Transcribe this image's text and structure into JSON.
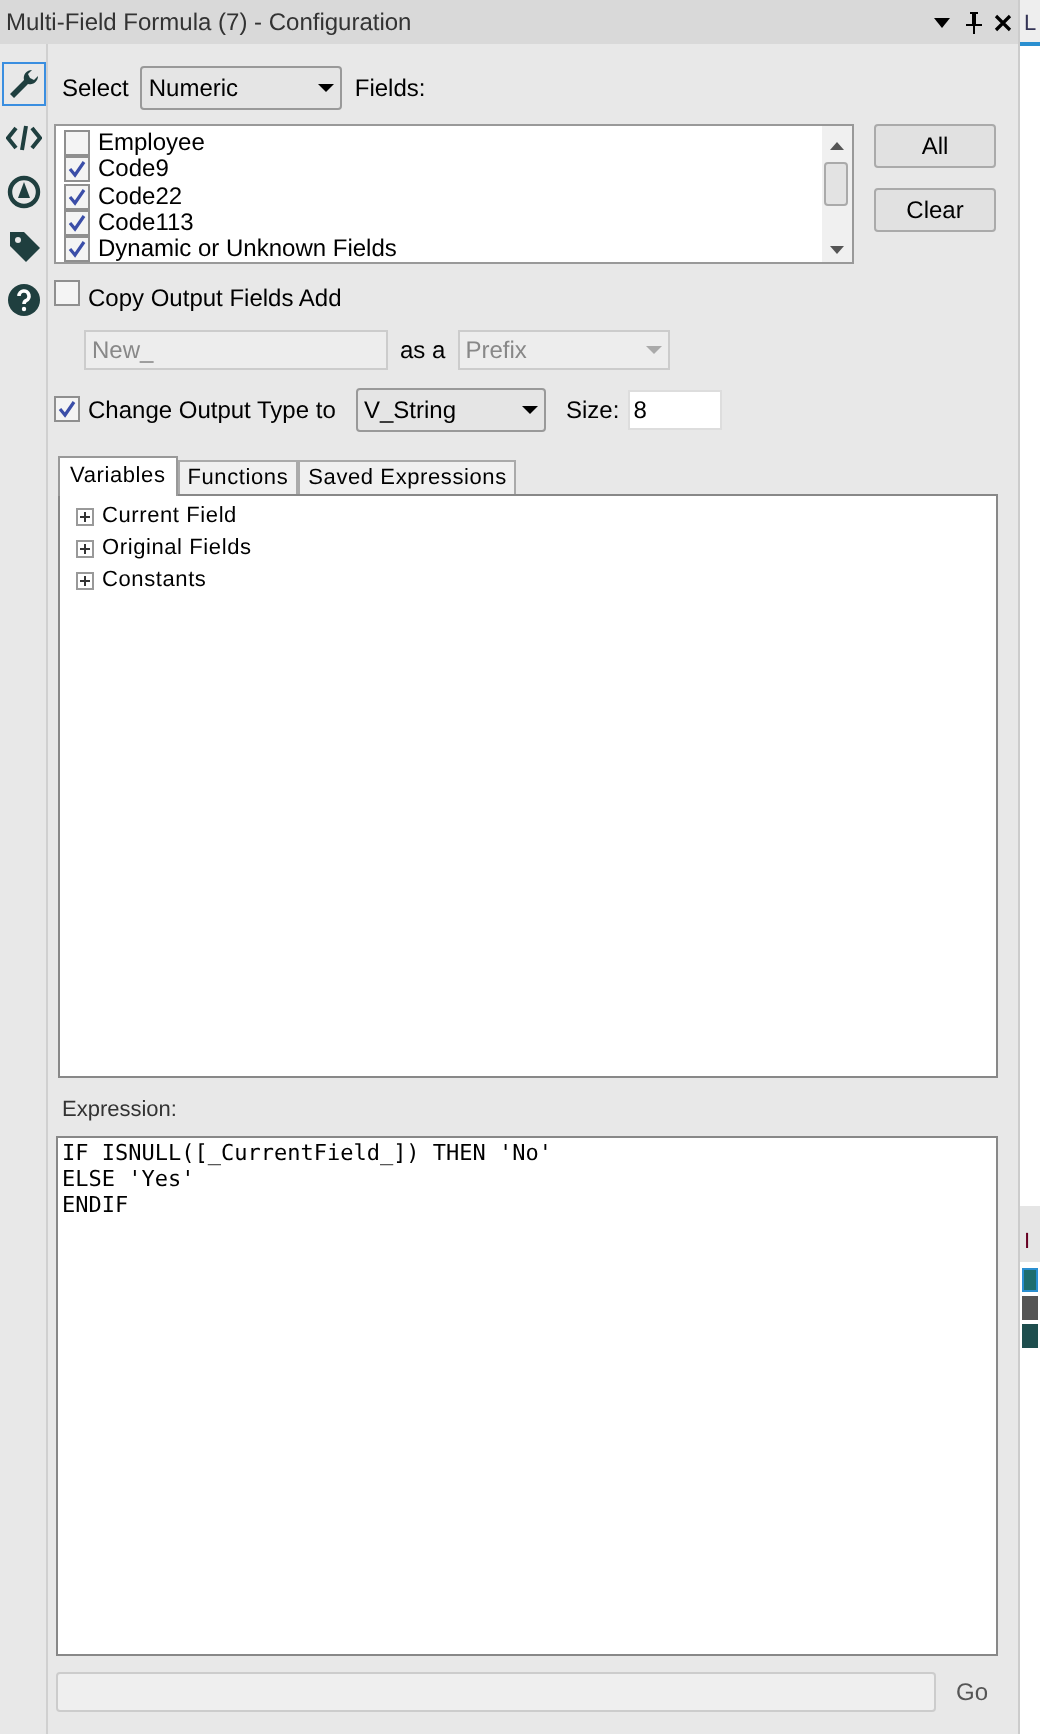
{
  "window": {
    "title": "Multi-Field Formula (7) - Configuration"
  },
  "side_tools": [
    {
      "kind": "wrench",
      "selected": true
    },
    {
      "kind": "code",
      "selected": false
    },
    {
      "kind": "compass",
      "selected": false
    },
    {
      "kind": "tag",
      "selected": false
    },
    {
      "kind": "help",
      "selected": false
    }
  ],
  "select": {
    "label": "Select",
    "value": "Numeric",
    "fields_label": "Fields:"
  },
  "fields": [
    {
      "label": "Employee",
      "checked": false
    },
    {
      "label": "Code9",
      "checked": true
    },
    {
      "label": "Code22",
      "checked": true
    },
    {
      "label": "Code113",
      "checked": true
    },
    {
      "label": "Dynamic or Unknown Fields",
      "checked": true
    }
  ],
  "list_buttons": [
    "All",
    "Clear"
  ],
  "copy_output": {
    "label": "Copy Output Fields Add",
    "checked": false,
    "text_value": "New_",
    "as_label": "as a",
    "mode": "Prefix"
  },
  "change_type": {
    "label": "Change Output Type to",
    "checked": true,
    "type": "V_String",
    "size_label": "Size:",
    "size": "8"
  },
  "tabs": [
    {
      "label": "Variables",
      "selected": true
    },
    {
      "label": "Functions",
      "selected": false
    },
    {
      "label": "Saved Expressions",
      "selected": false
    }
  ],
  "tree": [
    {
      "label": "Current Field",
      "expanded": false
    },
    {
      "label": "Original Fields",
      "expanded": false
    },
    {
      "label": "Constants",
      "expanded": false
    }
  ],
  "expression": {
    "label": "Expression:",
    "lines": [
      "IF ISNULL([_CurrentField_]) THEN 'No'",
      "ELSE 'Yes'",
      "ENDIF"
    ]
  },
  "go_button": "Go",
  "right_panel": {
    "tab": "L",
    "label": "I"
  }
}
